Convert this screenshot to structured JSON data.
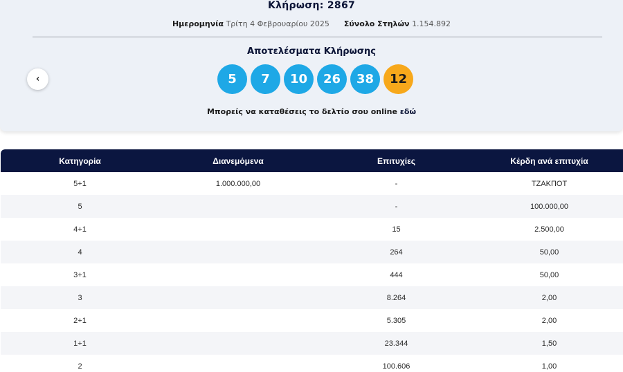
{
  "draw": {
    "title": "Κλήρωση: 2867",
    "date_label": "Ημερομηνία",
    "date_value": "Τρίτη 4 Φεβρουαρίου 2025",
    "columns_label": "Σύνολο Στηλών",
    "columns_value": "1.154.892"
  },
  "results": {
    "title": "Αποτελέσματα Κλήρωσης",
    "numbers": [
      "5",
      "7",
      "10",
      "26",
      "38"
    ],
    "bonus": "12",
    "main_color": "#1ea8e6",
    "bonus_color": "#f7a81b"
  },
  "nav": {
    "prev_label": "‹"
  },
  "deposit": {
    "text": "Μπορείς να καταθέσεις το δελτίο σου online ",
    "link": "εδώ"
  },
  "table": {
    "headers": [
      "Κατηγορία",
      "Διανεμόμενα",
      "Επιτυχίες",
      "Κέρδη ανά επιτυχία"
    ],
    "rows": [
      [
        "5+1",
        "1.000.000,00",
        "-",
        "ΤΖΑΚΠΟΤ"
      ],
      [
        "5",
        "",
        "-",
        "100.000,00"
      ],
      [
        "4+1",
        "",
        "15",
        "2.500,00"
      ],
      [
        "4",
        "",
        "264",
        "50,00"
      ],
      [
        "3+1",
        "",
        "444",
        "50,00"
      ],
      [
        "3",
        "",
        "8.264",
        "2,00"
      ],
      [
        "2+1",
        "",
        "5.305",
        "2,00"
      ],
      [
        "1+1",
        "",
        "23.344",
        "1,50"
      ],
      [
        "2",
        "",
        "100.606",
        "1,00"
      ]
    ],
    "header_color": "#0b1640"
  }
}
